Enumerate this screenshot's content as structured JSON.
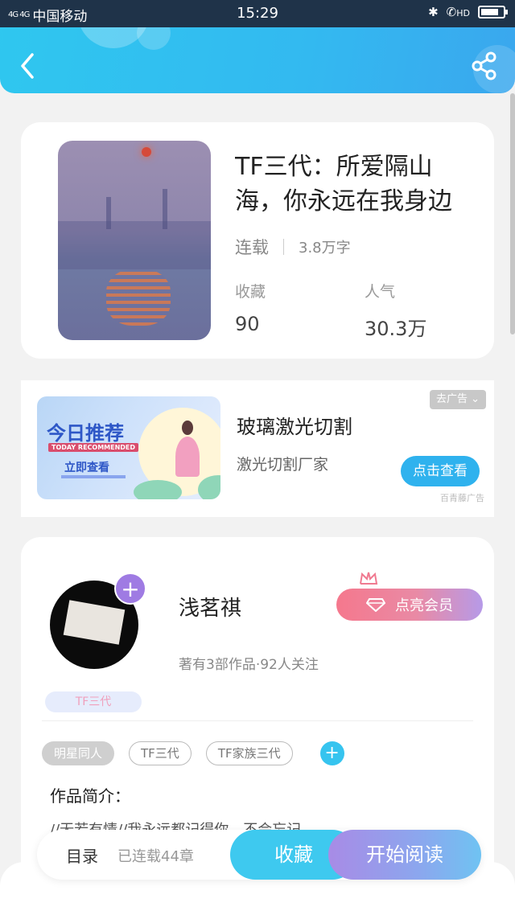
{
  "status_bar": {
    "network": "4G 4G",
    "carrier": "中国移动",
    "time": "15:29",
    "hd_label": "HD",
    "battery_level": 0.7
  },
  "header": {
    "back_icon": "chevron-left-icon",
    "share_icon": "share-icon",
    "accent_color": "#33b9f0"
  },
  "book": {
    "title": "TF三代：所爱隔山海，你永远在我身边",
    "status": "连载",
    "word_count": "3.8万字",
    "favorites_label": "收藏",
    "favorites_value": "90",
    "popularity_label": "人气",
    "popularity_value": "30.3万"
  },
  "ad": {
    "banner_title": "今日推荐",
    "banner_subtitle": "TODAY RECOMMENDED",
    "banner_cta": "立即查看",
    "title": "玻璃激光切割",
    "subtitle": "激光切割厂家",
    "close_label": "去广告",
    "cta_label": "点击查看",
    "source": "百青藤广告"
  },
  "author": {
    "name": "浅茗祺",
    "meta": "著有3部作品·92人关注",
    "vip_label": "点亮会员",
    "badge": "TF三代"
  },
  "tags": [
    "明星同人",
    "TF三代",
    "TF家族三代"
  ],
  "intro": {
    "title": "作品简介：",
    "text": "//无若有情//我永远都记得你，不会忘记"
  },
  "bottom_bar": {
    "toc_label": "目录",
    "toc_count": "已连载44章",
    "collect_label": "收藏",
    "read_label": "开始阅读"
  }
}
